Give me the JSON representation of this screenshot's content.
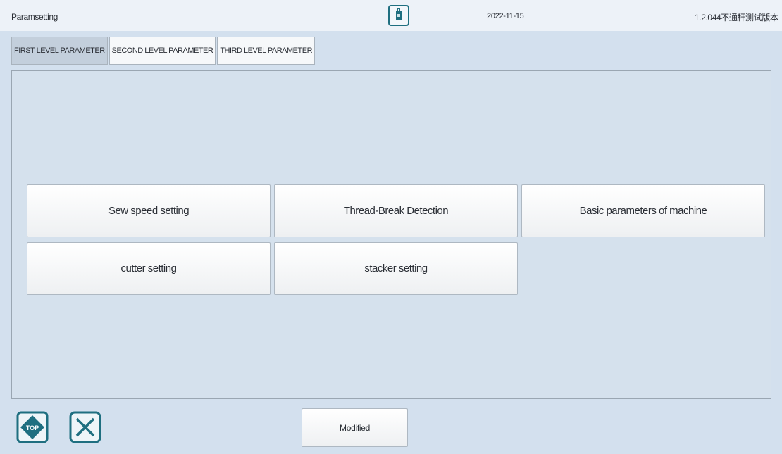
{
  "header": {
    "title": "Paramsetting",
    "usb_icon": "usb-drive-icon",
    "date": "2022-11-15",
    "version": "1.2.044不通秆测试版本"
  },
  "tabs": [
    {
      "label": "FIRST LEVEL PARAMETER",
      "active": true
    },
    {
      "label": "SECOND LEVEL PARAMETER",
      "active": false
    },
    {
      "label": "THIRD LEVEL PARAMETER",
      "active": false
    }
  ],
  "menu": {
    "items": [
      {
        "label": "Sew speed setting"
      },
      {
        "label": "Thread-Break Detection"
      },
      {
        "label": "Basic parameters of  machine"
      },
      {
        "label": "cutter setting"
      },
      {
        "label": "stacker setting"
      }
    ]
  },
  "footer": {
    "top_icon": "top-icon",
    "top_icon_text": "TOP",
    "close_icon": "close-icon",
    "modified_label": "Modified"
  },
  "colors": {
    "accent": "#1f6f80",
    "background": "#d3e0ee",
    "active_tab": "#c3cfdc"
  }
}
